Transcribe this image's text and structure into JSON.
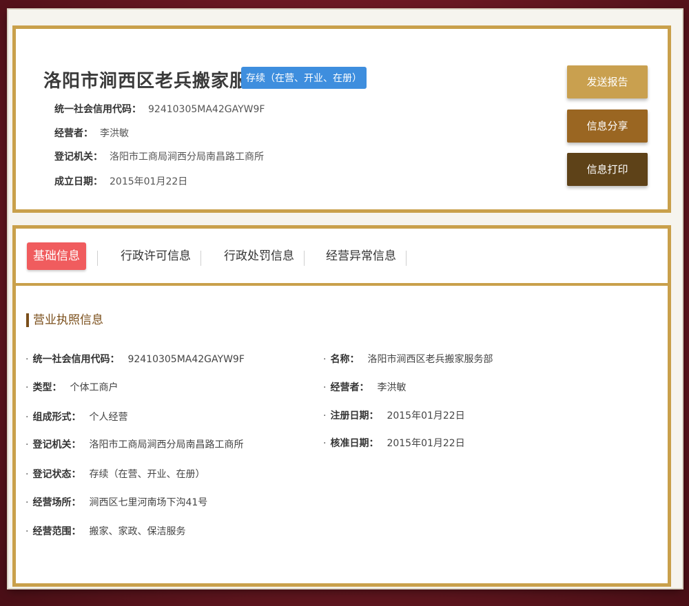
{
  "header": {
    "company_name": "洛阳市涧西区老兵搬家服务部",
    "status_badge": "存续（在营、开业、在册）",
    "info": [
      {
        "label": "统一社会信用代码：",
        "value": "92410305MA42GAYW9F"
      },
      {
        "label": "经营者：",
        "value": "李洪敏"
      },
      {
        "label": "登记机关：",
        "value": "洛阳市工商局涧西分局南昌路工商所"
      },
      {
        "label": "成立日期：",
        "value": "2015年01月22日"
      }
    ],
    "buttons": {
      "report": "发送报告",
      "share": "信息分享",
      "print": "信息打印"
    }
  },
  "tabs": [
    {
      "label": "基础信息"
    },
    {
      "label": "行政许可信息"
    },
    {
      "label": "行政处罚信息"
    },
    {
      "label": "经营异常信息"
    }
  ],
  "section": {
    "title": "营业执照信息",
    "left_fields": [
      {
        "label": "统一社会信用代码：",
        "value": "92410305MA42GAYW9F"
      },
      {
        "label": "类型：",
        "value": "个体工商户"
      },
      {
        "label": "组成形式：",
        "value": "个人经营"
      },
      {
        "label": "登记机关：",
        "value": "洛阳市工商局涧西分局南昌路工商所"
      },
      {
        "label": "登记状态：",
        "value": "存续（在营、开业、在册）"
      },
      {
        "label": "经营场所：",
        "value": "涧西区七里河南场下沟41号"
      },
      {
        "label": "经营范围：",
        "value": "搬家、家政、保洁服务"
      }
    ],
    "right_fields": [
      {
        "label": "名称：",
        "value": "洛阳市涧西区老兵搬家服务部"
      },
      {
        "label": "经营者：",
        "value": "李洪敏"
      },
      {
        "label": "注册日期：",
        "value": "2015年01月22日"
      },
      {
        "label": "核准日期：",
        "value": "2015年01月22日"
      }
    ]
  },
  "colors": {
    "gold_border": "#c9a04b",
    "badge_blue": "#3e8ede",
    "tab_active_red": "#f05c5e",
    "btn_report": "#c9a04f",
    "btn_share": "#9a6622",
    "btn_print": "#5e4218"
  }
}
